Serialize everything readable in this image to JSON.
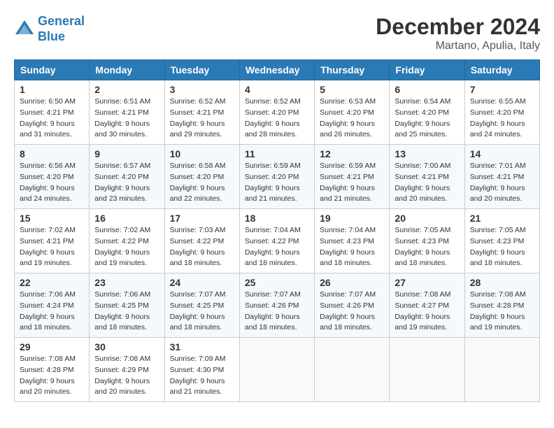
{
  "header": {
    "logo_line1": "General",
    "logo_line2": "Blue",
    "month": "December 2024",
    "location": "Martano, Apulia, Italy"
  },
  "weekdays": [
    "Sunday",
    "Monday",
    "Tuesday",
    "Wednesday",
    "Thursday",
    "Friday",
    "Saturday"
  ],
  "weeks": [
    [
      {
        "day": "1",
        "sunrise": "Sunrise: 6:50 AM",
        "sunset": "Sunset: 4:21 PM",
        "daylight": "Daylight: 9 hours and 31 minutes."
      },
      {
        "day": "2",
        "sunrise": "Sunrise: 6:51 AM",
        "sunset": "Sunset: 4:21 PM",
        "daylight": "Daylight: 9 hours and 30 minutes."
      },
      {
        "day": "3",
        "sunrise": "Sunrise: 6:52 AM",
        "sunset": "Sunset: 4:21 PM",
        "daylight": "Daylight: 9 hours and 29 minutes."
      },
      {
        "day": "4",
        "sunrise": "Sunrise: 6:52 AM",
        "sunset": "Sunset: 4:20 PM",
        "daylight": "Daylight: 9 hours and 28 minutes."
      },
      {
        "day": "5",
        "sunrise": "Sunrise: 6:53 AM",
        "sunset": "Sunset: 4:20 PM",
        "daylight": "Daylight: 9 hours and 26 minutes."
      },
      {
        "day": "6",
        "sunrise": "Sunrise: 6:54 AM",
        "sunset": "Sunset: 4:20 PM",
        "daylight": "Daylight: 9 hours and 25 minutes."
      },
      {
        "day": "7",
        "sunrise": "Sunrise: 6:55 AM",
        "sunset": "Sunset: 4:20 PM",
        "daylight": "Daylight: 9 hours and 24 minutes."
      }
    ],
    [
      {
        "day": "8",
        "sunrise": "Sunrise: 6:56 AM",
        "sunset": "Sunset: 4:20 PM",
        "daylight": "Daylight: 9 hours and 24 minutes."
      },
      {
        "day": "9",
        "sunrise": "Sunrise: 6:57 AM",
        "sunset": "Sunset: 4:20 PM",
        "daylight": "Daylight: 9 hours and 23 minutes."
      },
      {
        "day": "10",
        "sunrise": "Sunrise: 6:58 AM",
        "sunset": "Sunset: 4:20 PM",
        "daylight": "Daylight: 9 hours and 22 minutes."
      },
      {
        "day": "11",
        "sunrise": "Sunrise: 6:59 AM",
        "sunset": "Sunset: 4:20 PM",
        "daylight": "Daylight: 9 hours and 21 minutes."
      },
      {
        "day": "12",
        "sunrise": "Sunrise: 6:59 AM",
        "sunset": "Sunset: 4:21 PM",
        "daylight": "Daylight: 9 hours and 21 minutes."
      },
      {
        "day": "13",
        "sunrise": "Sunrise: 7:00 AM",
        "sunset": "Sunset: 4:21 PM",
        "daylight": "Daylight: 9 hours and 20 minutes."
      },
      {
        "day": "14",
        "sunrise": "Sunrise: 7:01 AM",
        "sunset": "Sunset: 4:21 PM",
        "daylight": "Daylight: 9 hours and 20 minutes."
      }
    ],
    [
      {
        "day": "15",
        "sunrise": "Sunrise: 7:02 AM",
        "sunset": "Sunset: 4:21 PM",
        "daylight": "Daylight: 9 hours and 19 minutes."
      },
      {
        "day": "16",
        "sunrise": "Sunrise: 7:02 AM",
        "sunset": "Sunset: 4:22 PM",
        "daylight": "Daylight: 9 hours and 19 minutes."
      },
      {
        "day": "17",
        "sunrise": "Sunrise: 7:03 AM",
        "sunset": "Sunset: 4:22 PM",
        "daylight": "Daylight: 9 hours and 18 minutes."
      },
      {
        "day": "18",
        "sunrise": "Sunrise: 7:04 AM",
        "sunset": "Sunset: 4:22 PM",
        "daylight": "Daylight: 9 hours and 18 minutes."
      },
      {
        "day": "19",
        "sunrise": "Sunrise: 7:04 AM",
        "sunset": "Sunset: 4:23 PM",
        "daylight": "Daylight: 9 hours and 18 minutes."
      },
      {
        "day": "20",
        "sunrise": "Sunrise: 7:05 AM",
        "sunset": "Sunset: 4:23 PM",
        "daylight": "Daylight: 9 hours and 18 minutes."
      },
      {
        "day": "21",
        "sunrise": "Sunrise: 7:05 AM",
        "sunset": "Sunset: 4:23 PM",
        "daylight": "Daylight: 9 hours and 18 minutes."
      }
    ],
    [
      {
        "day": "22",
        "sunrise": "Sunrise: 7:06 AM",
        "sunset": "Sunset: 4:24 PM",
        "daylight": "Daylight: 9 hours and 18 minutes."
      },
      {
        "day": "23",
        "sunrise": "Sunrise: 7:06 AM",
        "sunset": "Sunset: 4:25 PM",
        "daylight": "Daylight: 9 hours and 18 minutes."
      },
      {
        "day": "24",
        "sunrise": "Sunrise: 7:07 AM",
        "sunset": "Sunset: 4:25 PM",
        "daylight": "Daylight: 9 hours and 18 minutes."
      },
      {
        "day": "25",
        "sunrise": "Sunrise: 7:07 AM",
        "sunset": "Sunset: 4:26 PM",
        "daylight": "Daylight: 9 hours and 18 minutes."
      },
      {
        "day": "26",
        "sunrise": "Sunrise: 7:07 AM",
        "sunset": "Sunset: 4:26 PM",
        "daylight": "Daylight: 9 hours and 18 minutes."
      },
      {
        "day": "27",
        "sunrise": "Sunrise: 7:08 AM",
        "sunset": "Sunset: 4:27 PM",
        "daylight": "Daylight: 9 hours and 19 minutes."
      },
      {
        "day": "28",
        "sunrise": "Sunrise: 7:08 AM",
        "sunset": "Sunset: 4:28 PM",
        "daylight": "Daylight: 9 hours and 19 minutes."
      }
    ],
    [
      {
        "day": "29",
        "sunrise": "Sunrise: 7:08 AM",
        "sunset": "Sunset: 4:28 PM",
        "daylight": "Daylight: 9 hours and 20 minutes."
      },
      {
        "day": "30",
        "sunrise": "Sunrise: 7:08 AM",
        "sunset": "Sunset: 4:29 PM",
        "daylight": "Daylight: 9 hours and 20 minutes."
      },
      {
        "day": "31",
        "sunrise": "Sunrise: 7:09 AM",
        "sunset": "Sunset: 4:30 PM",
        "daylight": "Daylight: 9 hours and 21 minutes."
      },
      null,
      null,
      null,
      null
    ]
  ]
}
